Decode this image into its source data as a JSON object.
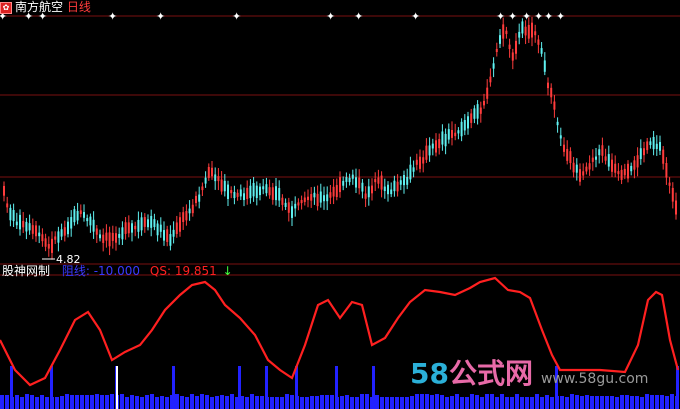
{
  "header": {
    "stock_name": "南方航空",
    "period": "日线"
  },
  "price_panel": {
    "low_label": "4.82",
    "up_markers": [
      "✦",
      "✦",
      "✦",
      "✦",
      "✦",
      "✦",
      "✦"
    ],
    "hline_color": "#7a1010"
  },
  "indicator_panel": {
    "name": "股神网制",
    "line1_label": "阻线:",
    "line1_value": "-10.000",
    "line2_label": "QS:",
    "line2_value": "19.851",
    "arrow": "↓"
  },
  "watermark": {
    "brand_num": "58",
    "brand_text": "公式网",
    "url": "www.58gu.com"
  },
  "colors": {
    "up": "#ff3c3c",
    "down": "#5ff0f0",
    "qs_line": "#ff2020",
    "bars": "#2222ff",
    "marker": "#ffffff"
  }
}
